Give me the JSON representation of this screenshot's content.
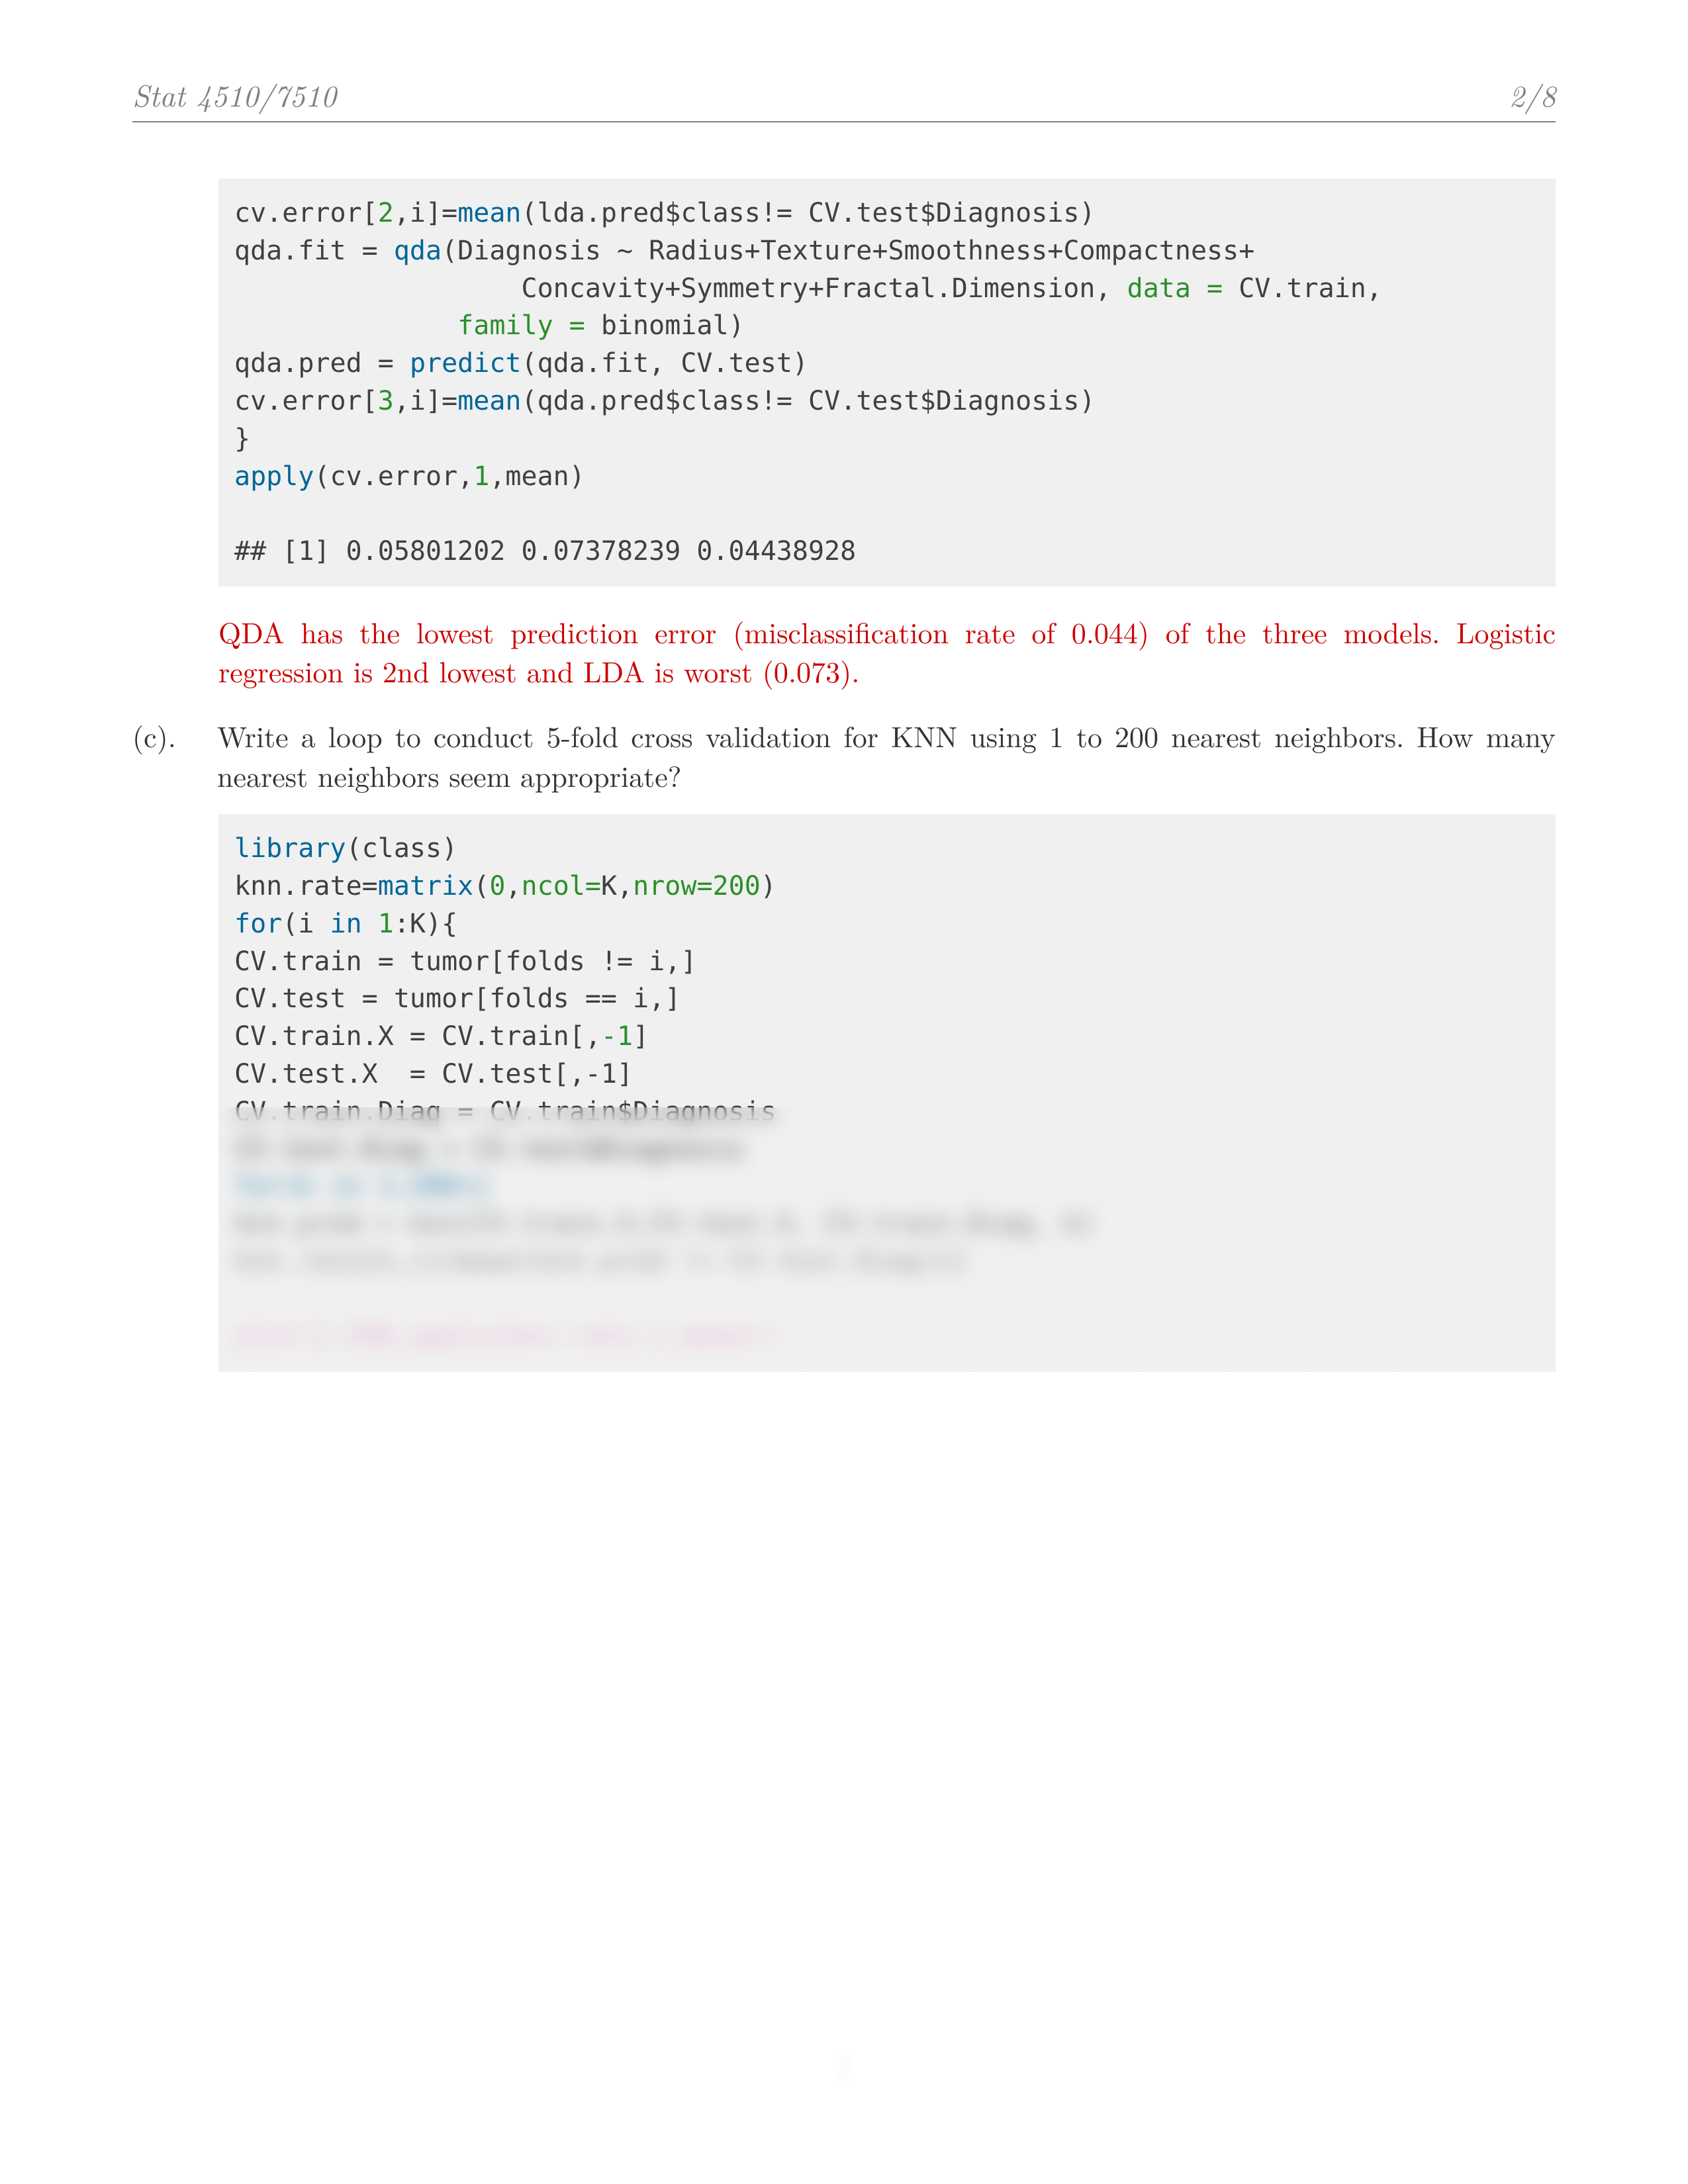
{
  "header": {
    "course": "Stat 4510/7510",
    "page": "2/8"
  },
  "code1": {
    "l1_a": "cv.error[",
    "l1_b": "2",
    "l1_c": ",i]",
    "l1_d": "=",
    "l1_e": "mean",
    "l1_f": "(lda.pred",
    "l1_g": "$",
    "l1_h": "class",
    "l1_i": "!=",
    "l1_j": " CV.test",
    "l1_k": "$",
    "l1_l": "Diagnosis)",
    "l2_a": "qda.fit ",
    "l2_b": "=",
    "l2_c": " ",
    "l2_d": "qda",
    "l2_e": "(Diagnosis ",
    "l2_f": "~",
    "l2_g": " Radius",
    "l2_h": "+",
    "l2_i": "Texture",
    "l2_j": "+",
    "l2_k": "Smoothness",
    "l2_l": "+",
    "l2_m": "Compactness",
    "l2_n": "+",
    "l3_pad": "                  ",
    "l3_a": "Concavity",
    "l3_b": "+",
    "l3_c": "Symmetry",
    "l3_d": "+",
    "l3_e": "Fractal.Dimension, ",
    "l3_f": "data =",
    "l3_g": " CV.train,",
    "l4_pad": "              ",
    "l4_a": "family =",
    "l4_b": " binomial)",
    "l5_a": "qda.pred ",
    "l5_b": "=",
    "l5_c": " ",
    "l5_d": "predict",
    "l5_e": "(qda.fit, CV.test)",
    "l6_a": "cv.error[",
    "l6_b": "3",
    "l6_c": ",i]",
    "l6_d": "=",
    "l6_e": "mean",
    "l6_f": "(qda.pred",
    "l6_g": "$",
    "l6_h": "class",
    "l6_i": "!=",
    "l6_j": " CV.test",
    "l6_k": "$",
    "l6_l": "Diagnosis)",
    "l7": "}",
    "l8_a": "apply",
    "l8_b": "(cv.error,",
    "l8_c": "1",
    "l8_d": ",mean)",
    "out": "## [1] 0.05801202 0.07378239 0.04438928"
  },
  "answer1": "QDA has the lowest prediction error (misclassification rate of 0.044) of the three models. Logistic regression is 2nd lowest and LDA is worst (0.073).",
  "question_c_label": "(c).",
  "question_c_text": "Write a loop to conduct 5-fold cross validation for KNN using 1 to 200 nearest neighbors. How many nearest neighbors seem appropriate?",
  "code2": {
    "l1_a": "library",
    "l1_b": "(class)",
    "l2_a": "knn.rate",
    "l2_b": "=",
    "l2_c": "matrix",
    "l2_d": "(",
    "l2_e": "0",
    "l2_f": ",",
    "l2_g": "ncol=",
    "l2_h": "K,",
    "l2_i": "nrow=",
    "l2_j": "200",
    "l2_k": ")",
    "l3_a": "for",
    "l3_b": "(i ",
    "l3_c": "in",
    "l3_d": " ",
    "l3_e": "1",
    "l3_f": ":",
    "l3_g": "K){",
    "l4_a": "CV.train ",
    "l4_b": "=",
    "l4_c": " tumor[folds ",
    "l4_d": "!=",
    "l4_e": " i,]",
    "l5_a": "CV.test ",
    "l5_b": "=",
    "l5_c": " tumor[folds ",
    "l5_d": "==",
    "l5_e": " i,]",
    "l6_a": "CV.train.X ",
    "l6_b": "=",
    "l6_c": " CV.train[,",
    "l6_d": "-1",
    "l6_e": "]",
    "h1": "CV.test.X  = CV.test[,-1]",
    "h2": "CV.train.Diag = CV.train$Diagnosis",
    "h3": "CV.test.Diag = CV.test$Diagnosis",
    "h4": "for(k in 1:200){",
    "h5": "knn.pred = knn(CV.train.X,CV.test.X, CV.train.Diag, k)",
    "h6": "knn.rate[k,i]=mean(knn.pred != CV.test.Diag)}}",
    "h7": "",
    "h8": "plot(1:200,apply(knn.rate,1,mean))"
  },
  "footer_page": "2"
}
